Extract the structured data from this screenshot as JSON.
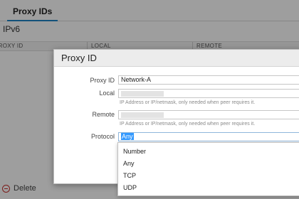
{
  "background": {
    "tab_label": "Proxy IDs",
    "subtab_label": "IPv6",
    "columns": [
      "PROXY ID",
      "LOCAL",
      "REMOTE"
    ],
    "delete_label": "Delete"
  },
  "dialog": {
    "title": "Proxy ID",
    "proxy_id": {
      "label": "Proxy ID",
      "value": "Network-A"
    },
    "local": {
      "label": "Local",
      "hint": "IP Address or IP/netmask, only needed when peer requires it."
    },
    "remote": {
      "label": "Remote",
      "hint": "IP Address or IP/netmask, only needed when peer requires it."
    },
    "protocol": {
      "label": "Protocol",
      "value": "Any"
    }
  },
  "protocol_options": [
    "Number",
    "Any",
    "TCP",
    "UDP"
  ],
  "colors": {
    "accent": "#1f84c6",
    "selection": "#3399ff",
    "delete": "#c9302c"
  }
}
